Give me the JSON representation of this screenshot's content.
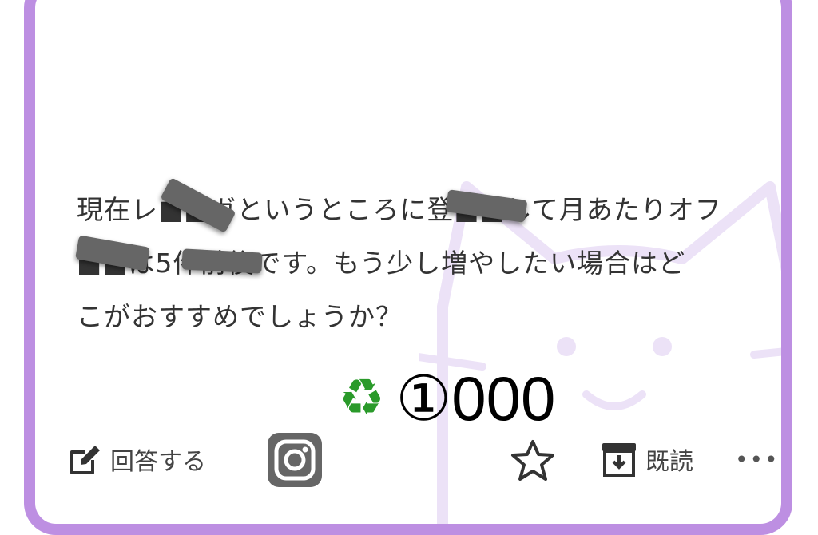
{
  "question": {
    "lines": [
      "現在レ■■ガというところに登■■して月あたりオフ",
      "■■は5件前後です。もう少し増やしたい場合はど",
      "こがおすすめでしょうか？"
    ]
  },
  "stamp": {
    "icon": "recycle-icon",
    "text": "①000"
  },
  "actions": {
    "answer_label": "回答する",
    "answer_icon": "edit-icon",
    "instagram_icon": "instagram-icon",
    "star_icon": "star-icon",
    "read_label": "既読",
    "read_icon": "archive-icon",
    "more_icon": "more-icon",
    "more_glyph": "•••"
  },
  "colors": {
    "border": "#bd8fe2",
    "watermark": "#ece2f7",
    "text": "#333333"
  }
}
